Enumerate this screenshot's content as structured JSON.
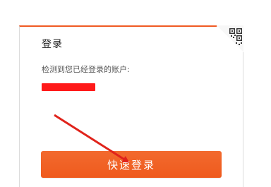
{
  "login_panel": {
    "title": "登录",
    "subtitle": "检测到您已经登录的账户:",
    "account_name": "",
    "quick_login_button": "快速登录",
    "qr_toggle_icon": "qr-code-icon"
  },
  "colors": {
    "accent": "#f05a23",
    "button": "#ef5a1d",
    "redaction": "#ff1a1a",
    "annotation_arrow": "#e0231b"
  }
}
